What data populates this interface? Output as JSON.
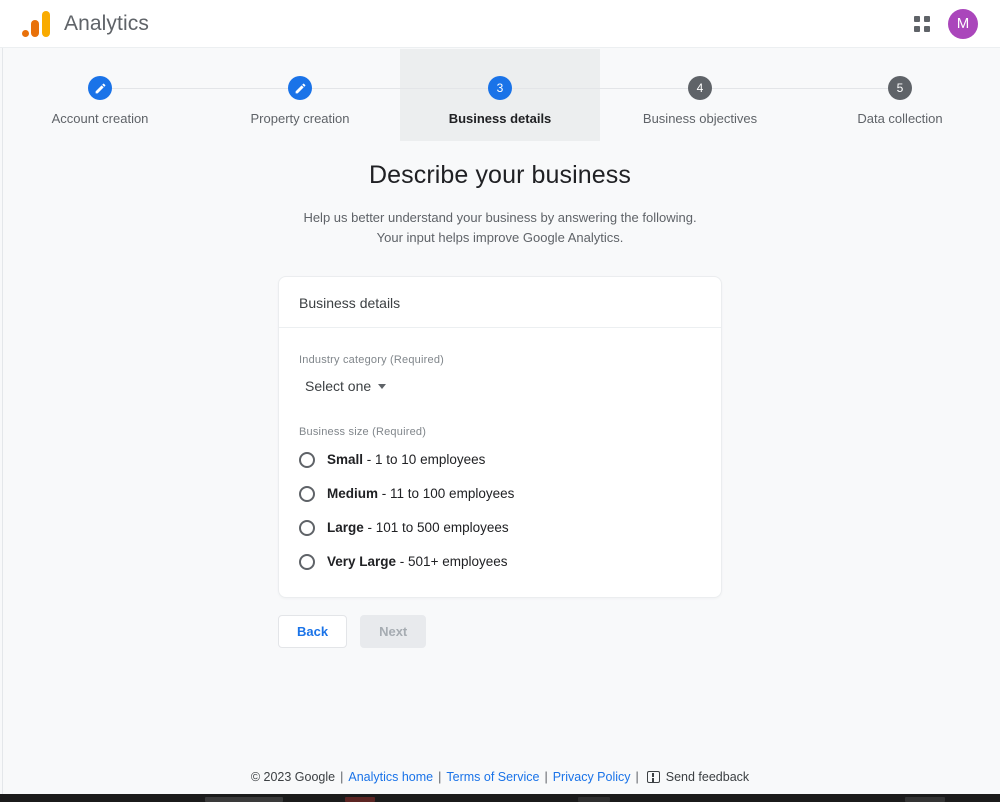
{
  "header": {
    "brand_name": "Analytics",
    "logo_icon": "google-analytics-logo",
    "apps_icon": "apps-grid-icon",
    "avatar_initial": "M",
    "avatar_color": "#aa46bb"
  },
  "stepper": {
    "active_index": 2,
    "steps": [
      {
        "number": "1",
        "label": "Account creation",
        "state": "completed",
        "icon": "pencil-icon"
      },
      {
        "number": "2",
        "label": "Property creation",
        "state": "completed",
        "icon": "pencil-icon"
      },
      {
        "number": "3",
        "label": "Business details",
        "state": "active",
        "icon": "number"
      },
      {
        "number": "4",
        "label": "Business objectives",
        "state": "upcoming",
        "icon": "number"
      },
      {
        "number": "5",
        "label": "Data collection",
        "state": "upcoming",
        "icon": "number"
      }
    ]
  },
  "main": {
    "title": "Describe your business",
    "subtitle_line1": "Help us better understand your business by answering the following.",
    "subtitle_line2": "Your input helps improve Google Analytics."
  },
  "card": {
    "header": "Business details",
    "industry": {
      "label": "Industry category (Required)",
      "selected_value": "Select one",
      "caret_icon": "caret-down-icon"
    },
    "business_size": {
      "label": "Business size (Required)",
      "selected": null,
      "options": [
        {
          "name": "Small",
          "detail": " - 1 to 10 employees"
        },
        {
          "name": "Medium",
          "detail": " - 11 to 100 employees"
        },
        {
          "name": "Large",
          "detail": " - 101 to 500 employees"
        },
        {
          "name": "Very Large",
          "detail": " - 501+ employees"
        }
      ]
    }
  },
  "actions": {
    "back_label": "Back",
    "next_label": "Next",
    "next_disabled": true
  },
  "footer": {
    "copyright": "© 2023 Google",
    "sep": "|",
    "analytics_home": "Analytics home",
    "terms": "Terms of Service",
    "privacy": "Privacy Policy",
    "feedback_label": "Send feedback",
    "feedback_icon": "feedback-icon"
  },
  "colors": {
    "accent_blue": "#1a73e8",
    "step_gray": "#5f6368",
    "page_background": "#f8f9fa",
    "active_step_background": "#eceeef"
  }
}
